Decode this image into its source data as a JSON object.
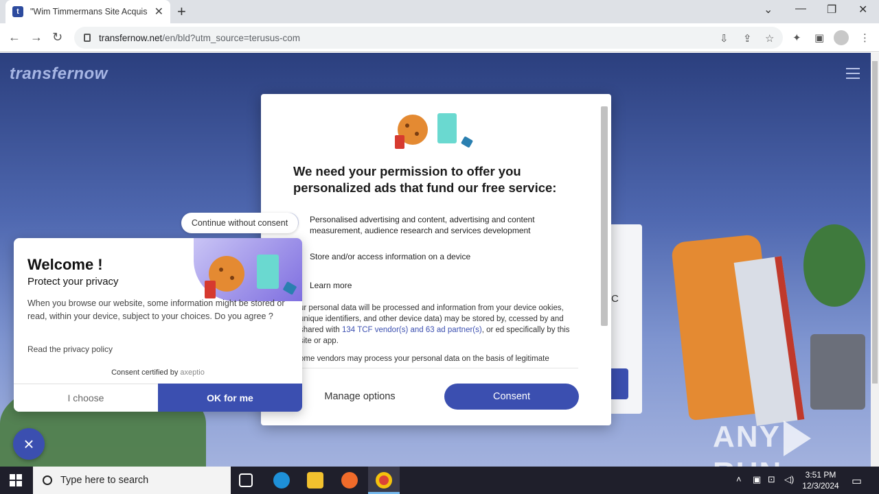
{
  "browser": {
    "tab_title": "\"Wim Timmermans Site Acquisit",
    "tab_favicon": "t",
    "url_host": "transfernow.net",
    "url_path": "/en/bld?utm_source=terusus-com"
  },
  "page": {
    "logo": "transfernow",
    "bg_card_text": "C"
  },
  "modal": {
    "title": "We need your permission to offer you personalized ads that fund our free service:",
    "purposes": [
      {
        "text": "Personalised advertising and content, advertising and content measurement, audience research and services development",
        "icon": "user-icon"
      },
      {
        "text": "Store and/or access information on a device",
        "icon": "device-icon"
      },
      {
        "text": "Learn more",
        "icon": "check-icon"
      }
    ],
    "body_before_link": "ur personal data will be processed and information from your device ookies, unique identifiers, and other device data) may be stored by, ccessed by and shared with ",
    "body_link": "134 TCF vendor(s) and 63 ad partner(s)",
    "body_after_link": ", or ed specifically by this site or app.",
    "body2": "ome vendors may process your personal data on the basis of legitimate",
    "manage_label": "Manage options",
    "consent_label": "Consent"
  },
  "axeptio": {
    "continue_label": "Continue without consent",
    "title": "Welcome !",
    "subtitle": "Protect your privacy",
    "text": "When you browse our website, some information might be stored or read, within your device, subject to your choices. Do you agree ?",
    "privacy_link": "Read the privacy policy",
    "certified_prefix": "Consent certified by ",
    "certified_brand": "axeptio",
    "choose_label": "I choose",
    "ok_label": "OK for me",
    "close_symbol": "×"
  },
  "watermark": {
    "left": "ANY",
    "right": "RUN"
  },
  "taskbar": {
    "search_placeholder": "Type here to search",
    "time": "3:51 PM",
    "date": "12/3/2024"
  },
  "colors": {
    "accent": "#3b4fb0",
    "page_bg": "#4f68b0"
  }
}
